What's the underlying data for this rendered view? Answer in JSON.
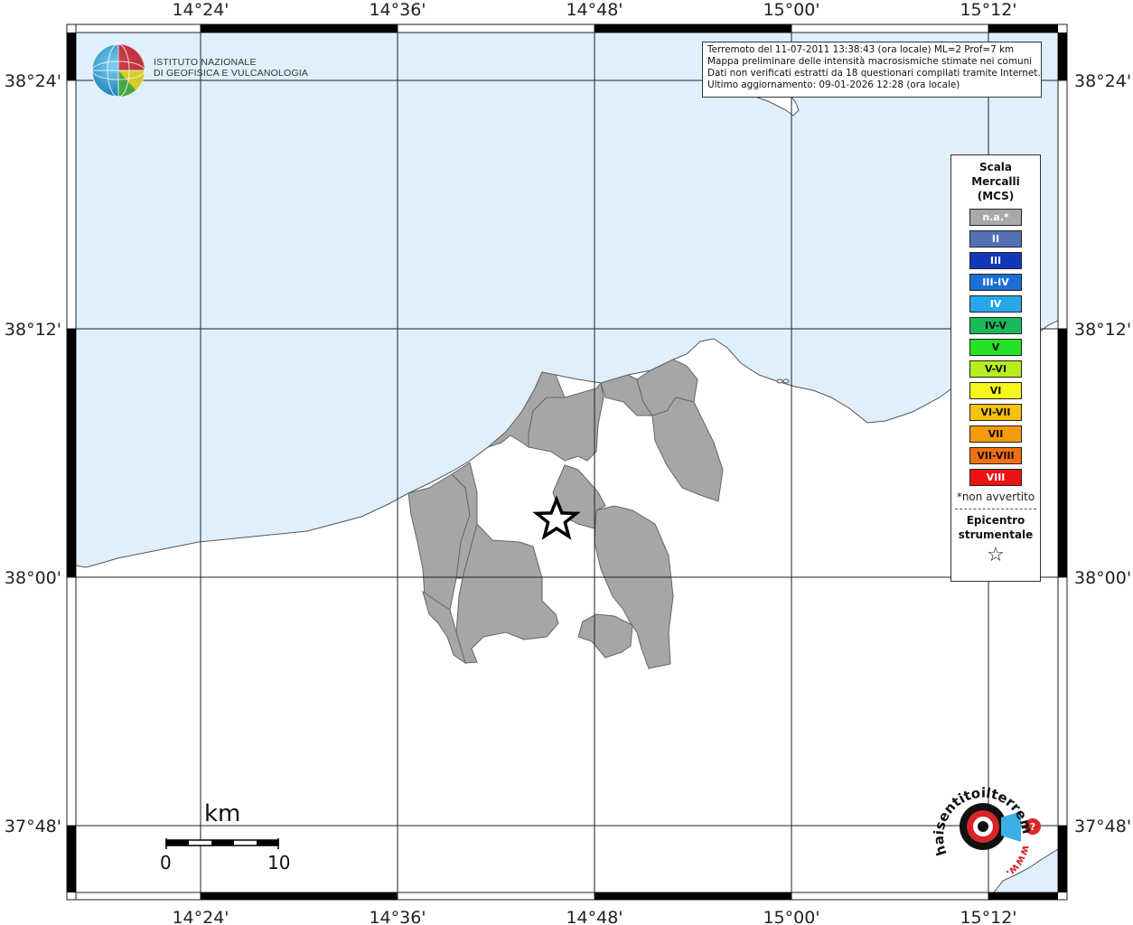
{
  "map": {
    "title_box": {
      "line1": "Terremoto del 11-07-2011 13:38:43 (ora locale) ML=2 Prof=7 km",
      "line2": "Mappa preliminare delle intensità macrosismiche stimate nei comuni",
      "line3": "Dati non verificati estratti da 18 questionari compilati tramite Internet.",
      "line4": "Ultimo aggiornamento: 09-01-2026 12:28 (ora locale)"
    },
    "lon_ticks": [
      "14°24'",
      "14°36'",
      "14°48'",
      "15°00'",
      "15°12'"
    ],
    "lat_ticks": [
      "38°24'",
      "38°12'",
      "38°00'",
      "37°48'"
    ],
    "colors": {
      "sea": "#dff0fc",
      "land": "#ffffff",
      "municipality": "#a6a6a6",
      "border": "#666666"
    }
  },
  "institution_logo": {
    "line1": "ISTITUTO NAZIONALE",
    "line2": "DI GEOFISICA E VULCANOLOGIA"
  },
  "legend": {
    "title_line1": "Scala",
    "title_line2": "Mercalli",
    "title_line3": "(MCS)",
    "items": [
      {
        "label": "n.a.*",
        "color": "#a9a9a9",
        "text_color": "#ffffff"
      },
      {
        "label": "II",
        "color": "#5470b4",
        "text_color": "#ffffff"
      },
      {
        "label": "III",
        "color": "#1238b8",
        "text_color": "#ffffff"
      },
      {
        "label": "III-IV",
        "color": "#1c6fd6",
        "text_color": "#ffffff"
      },
      {
        "label": "IV",
        "color": "#27a6e8",
        "text_color": "#ffffff"
      },
      {
        "label": "IV-V",
        "color": "#1aba5a",
        "text_color": "#111111"
      },
      {
        "label": "V",
        "color": "#27e127",
        "text_color": "#111111"
      },
      {
        "label": "V-VI",
        "color": "#b8ee1c",
        "text_color": "#111111"
      },
      {
        "label": "VI",
        "color": "#f7f71a",
        "text_color": "#111111"
      },
      {
        "label": "VI-VII",
        "color": "#f4c20d",
        "text_color": "#111111"
      },
      {
        "label": "VII",
        "color": "#f49a0d",
        "text_color": "#111111"
      },
      {
        "label": "VII-VIII",
        "color": "#f2700f",
        "text_color": "#111111"
      },
      {
        "label": "VIII",
        "color": "#ee1212",
        "text_color": "#ffffff"
      }
    ],
    "note": "*non avvertito",
    "epicenter_line1": "Epicentro",
    "epicenter_line2": "strumentale",
    "epicenter_symbol": "☆"
  },
  "scale_bar": {
    "unit": "km",
    "min": "0",
    "max": "10"
  },
  "hsit_logo": {
    "text": "haisentitoilterremoto.it",
    "url_prefix": "www."
  }
}
